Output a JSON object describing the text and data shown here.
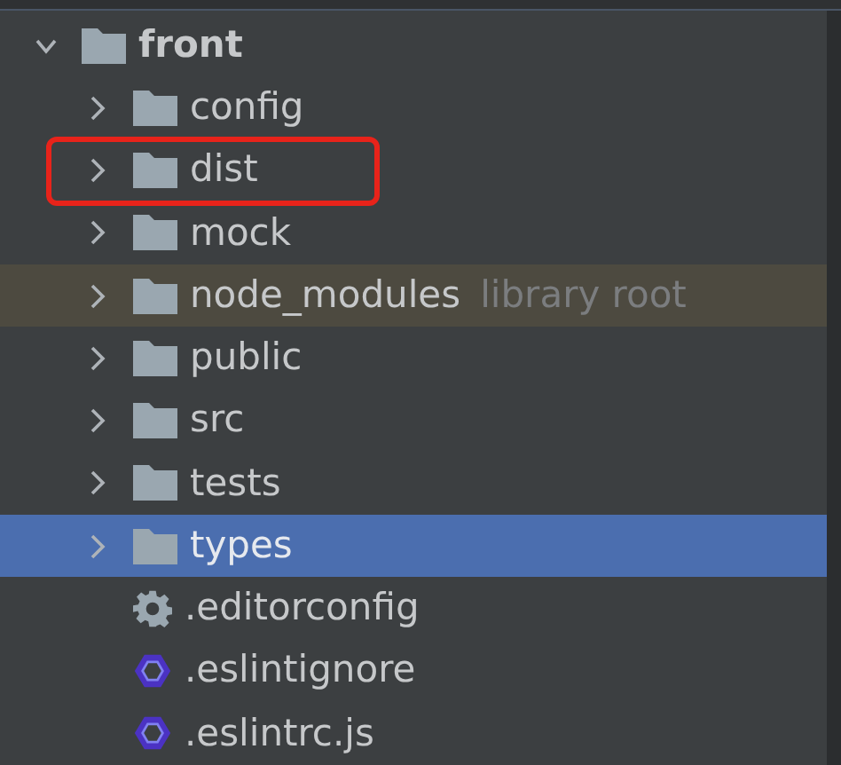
{
  "tree": {
    "name": "front",
    "expanded": true,
    "selected": false,
    "children": [
      {
        "kind": "folder",
        "name": "config",
        "expanded": false,
        "selected": false,
        "annotated": false,
        "library": false
      },
      {
        "kind": "folder",
        "name": "dist",
        "expanded": false,
        "selected": false,
        "annotated": true,
        "library": false
      },
      {
        "kind": "folder",
        "name": "mock",
        "expanded": false,
        "selected": false,
        "annotated": false,
        "library": false
      },
      {
        "kind": "folder",
        "name": "node_modules",
        "note": "library root",
        "expanded": false,
        "selected": false,
        "annotated": false,
        "library": true
      },
      {
        "kind": "folder",
        "name": "public",
        "expanded": false,
        "selected": false,
        "annotated": false,
        "library": false
      },
      {
        "kind": "folder",
        "name": "src",
        "expanded": false,
        "selected": false,
        "annotated": false,
        "library": false
      },
      {
        "kind": "folder",
        "name": "tests",
        "expanded": false,
        "selected": false,
        "annotated": false,
        "library": false
      },
      {
        "kind": "folder",
        "name": "types",
        "expanded": false,
        "selected": true,
        "annotated": false,
        "library": false
      },
      {
        "kind": "config-file",
        "name": ".editorconfig",
        "selected": false,
        "annotated": false,
        "library": false
      },
      {
        "kind": "eslint-file",
        "name": ".eslintignore",
        "selected": false,
        "annotated": false,
        "library": false
      },
      {
        "kind": "eslint-file",
        "name": ".eslintrc.js",
        "selected": false,
        "annotated": false,
        "library": false
      }
    ]
  }
}
